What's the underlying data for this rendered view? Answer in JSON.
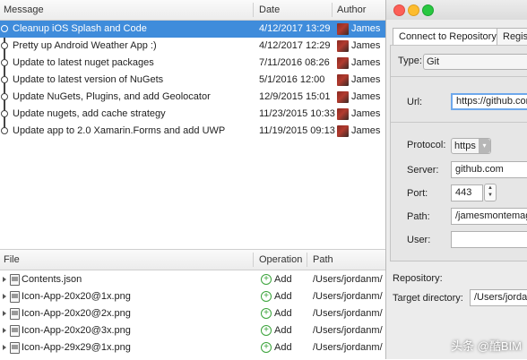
{
  "history": {
    "columns": {
      "message": "Message",
      "date": "Date",
      "author": "Author"
    },
    "commits": [
      {
        "message": "Cleanup iOS Splash and Code",
        "date": "4/12/2017 13:29",
        "author": "James"
      },
      {
        "message": "Pretty up Android Weather App :)",
        "date": "4/12/2017 12:29",
        "author": "James"
      },
      {
        "message": "Update to latest nuget packages",
        "date": "7/11/2016 08:26",
        "author": "James"
      },
      {
        "message": "Update to latest version of NuGets",
        "date": "5/1/2016 12:00",
        "author": "James"
      },
      {
        "message": "Update NuGets, Plugins, and add Geolocator",
        "date": "12/9/2015 15:01",
        "author": "James"
      },
      {
        "message": "Update nugets, add cache strategy",
        "date": "11/23/2015 10:33",
        "author": "James"
      },
      {
        "message": "Update app to 2.0 Xamarin.Forms and add UWP",
        "date": "11/19/2015 09:13",
        "author": "James"
      }
    ]
  },
  "files": {
    "columns": {
      "file": "File",
      "operation": "Operation",
      "path": "Path"
    },
    "items": [
      {
        "name": "Contents.json",
        "operation": "Add",
        "path": "/Users/jordanm/"
      },
      {
        "name": "Icon-App-20x20@1x.png",
        "operation": "Add",
        "path": "/Users/jordanm/"
      },
      {
        "name": "Icon-App-20x20@2x.png",
        "operation": "Add",
        "path": "/Users/jordanm/"
      },
      {
        "name": "Icon-App-20x20@3x.png",
        "operation": "Add",
        "path": "/Users/jordanm/"
      },
      {
        "name": "Icon-App-29x29@1x.png",
        "operation": "Add",
        "path": "/Users/jordanm/"
      }
    ]
  },
  "dialog": {
    "tabs": [
      "Connect to Repository",
      "Regist"
    ],
    "type_label": "Type:",
    "type_value": "Git",
    "url_label": "Url:",
    "url_value": "https://github.com/",
    "protocol_label": "Protocol:",
    "protocol_value": "https",
    "server_label": "Server:",
    "server_value": "github.com",
    "port_label": "Port:",
    "port_value": "443",
    "path_label": "Path:",
    "path_value": "/jamesmontemagno/",
    "user_label": "User:",
    "user_value": "",
    "repository_label": "Repository:",
    "target_label": "Target directory:",
    "target_value": "/Users/jordanm"
  },
  "watermark": "头条 @酷BIM",
  "colors": {
    "selection": "#3f8cdb",
    "add": "#3aa33a",
    "focus": "#6ea8ec"
  }
}
